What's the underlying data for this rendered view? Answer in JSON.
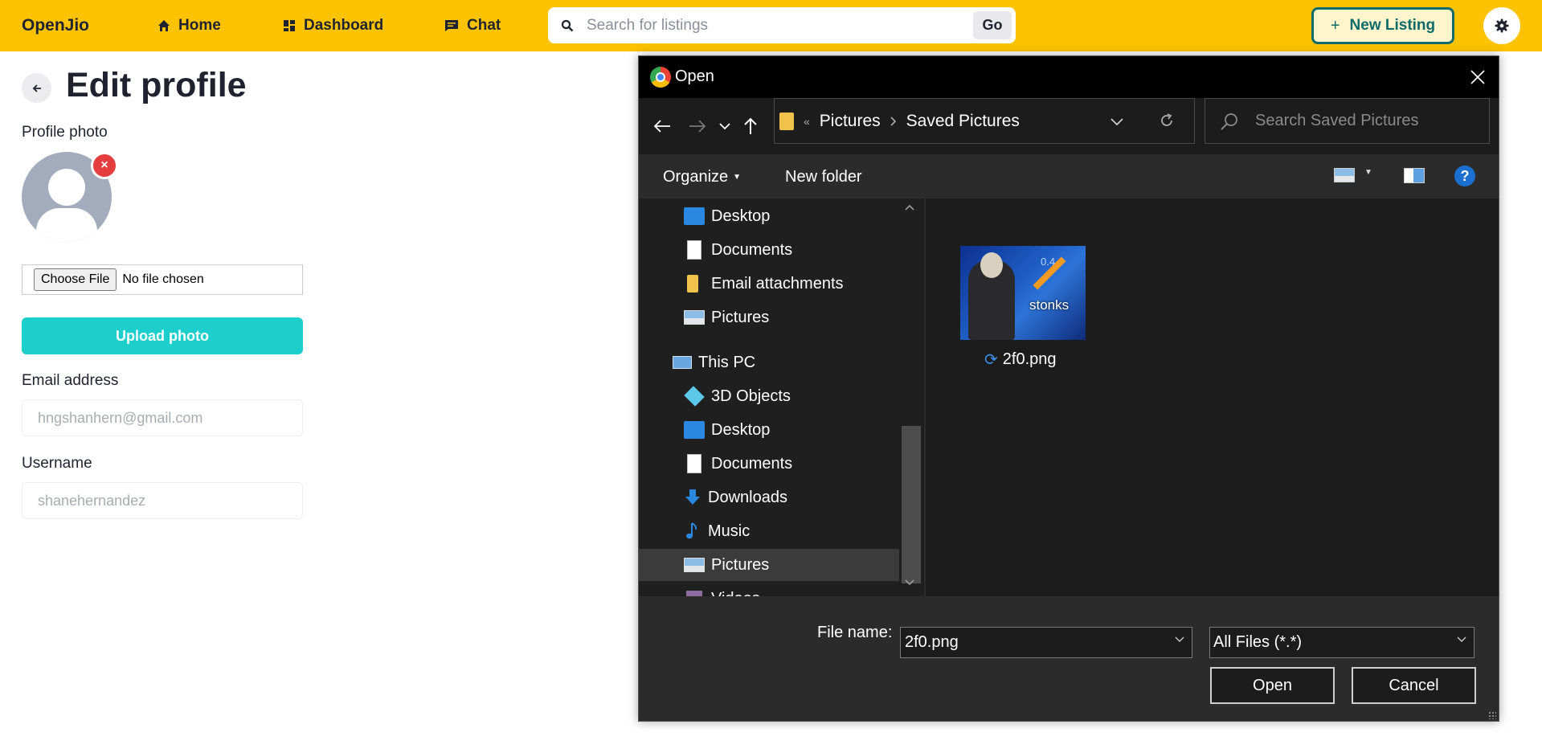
{
  "navbar": {
    "brand": "OpenJio",
    "links": [
      {
        "label": "Home",
        "icon": "home-icon"
      },
      {
        "label": "Dashboard",
        "icon": "dashboard-icon"
      },
      {
        "label": "Chat",
        "icon": "chat-icon"
      }
    ],
    "search_placeholder": "Search for listings",
    "search_button": "Go",
    "new_listing": "New Listing",
    "settings_icon": "gear-icon",
    "colors": {
      "bar": "#fdc300",
      "accent": "#116b6b"
    }
  },
  "profile": {
    "title": "Edit profile",
    "photo_label": "Profile photo",
    "remove_symbol": "×",
    "choose_file": "Choose File",
    "no_file": "No file chosen",
    "upload_button": "Upload photo",
    "email_label": "Email address",
    "email_placeholder": "hngshanhern@gmail.com",
    "username_label": "Username",
    "username_placeholder": "shanehernandez",
    "colors": {
      "upload": "#1ccfcc",
      "remove": "#e53e3e"
    }
  },
  "dialog": {
    "title": "Open",
    "address": {
      "overflow": "«",
      "segments": [
        "Pictures",
        "Saved Pictures"
      ]
    },
    "search_placeholder": "Search Saved Pictures",
    "toolbar": {
      "organize": "Organize",
      "new_folder": "New folder",
      "help": "?"
    },
    "tree": [
      {
        "label": "Desktop",
        "icon": "desktop-icon"
      },
      {
        "label": "Documents",
        "icon": "documents-icon"
      },
      {
        "label": "Email attachments",
        "icon": "folder-icon"
      },
      {
        "label": "Pictures",
        "icon": "pictures-icon"
      },
      {
        "label": "This PC",
        "icon": "this-pc-icon"
      },
      {
        "label": "3D Objects",
        "icon": "3d-objects-icon"
      },
      {
        "label": "Desktop",
        "icon": "desktop-icon"
      },
      {
        "label": "Documents",
        "icon": "documents-icon"
      },
      {
        "label": "Downloads",
        "icon": "downloads-icon"
      },
      {
        "label": "Music",
        "icon": "music-icon"
      },
      {
        "label": "Pictures",
        "icon": "pictures-icon",
        "selected": true
      },
      {
        "label": "Videos",
        "icon": "videos-icon"
      }
    ],
    "files": [
      {
        "name": "2f0.png",
        "thumb_text": "stonks",
        "thumb_number": "0.4"
      }
    ],
    "file_name_label": "File name:",
    "file_name_value": "2f0.png",
    "file_type": "All Files (*.*)",
    "open_button": "Open",
    "cancel_button": "Cancel"
  }
}
